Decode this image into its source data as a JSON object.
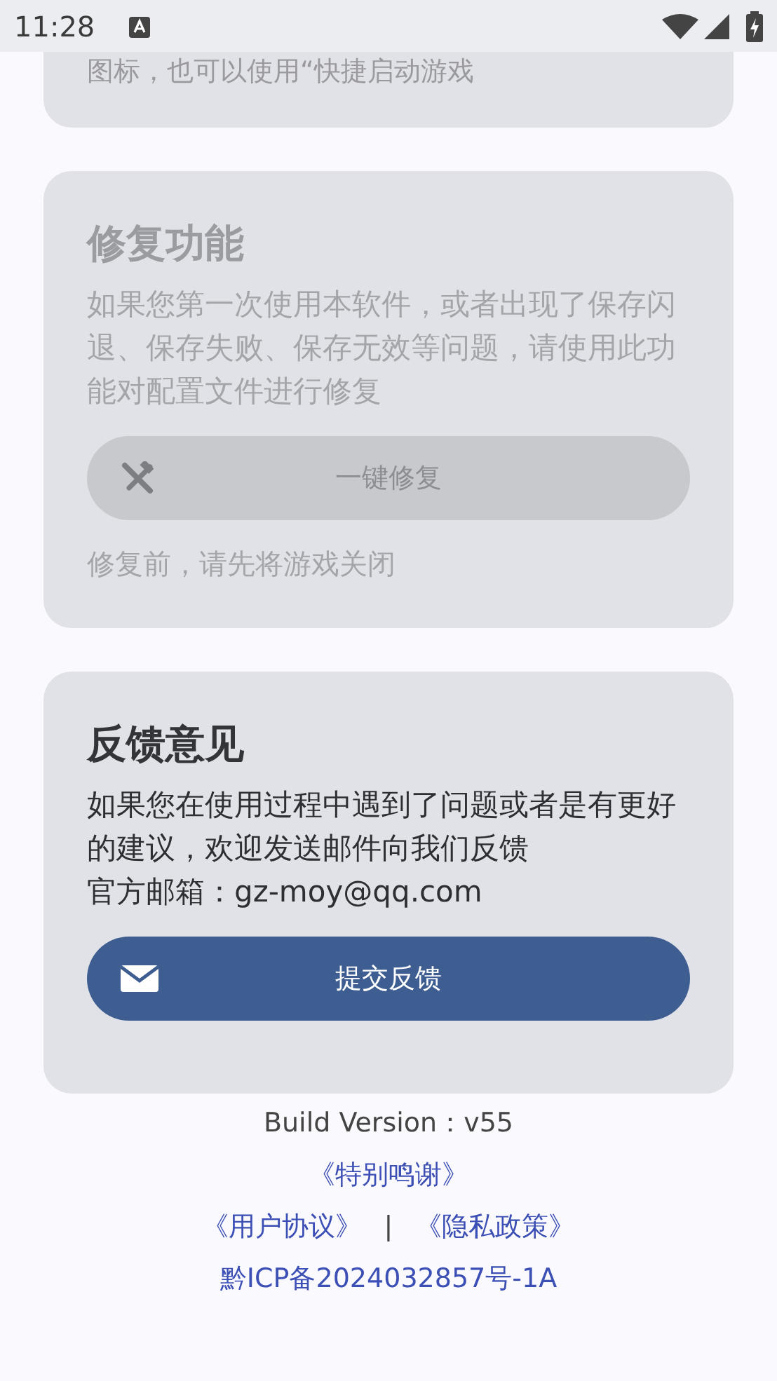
{
  "status_bar": {
    "time": "11:28"
  },
  "top_card": {
    "text": "图标，也可以使用“快捷启动游戏"
  },
  "repair_card": {
    "title": "修复功能",
    "description": "如果您第一次使用本软件，或者出现了保存闪退、保存失败、保存无效等问题，请使用此功能对配置文件进行修复",
    "button": {
      "label": "一键修复",
      "disabled": true
    },
    "note": "修复前，请先将游戏关闭",
    "disabled": true
  },
  "feedback_card": {
    "title": "反馈意见",
    "description": "如果您在使用过程中遇到了问题或者是有更好的建议，欢迎发送邮件向我们反馈",
    "email": "官方邮箱：gz-moy@qq.com",
    "button": {
      "label": "提交反馈",
      "disabled": false
    },
    "disabled": false
  },
  "footer": {
    "version": "Build Version：v55",
    "thanks_link": "《特别鸣谢》",
    "agreement_link": "《用户协议》",
    "separator": "|",
    "privacy_link": "《隐私政策》",
    "icp_link": "黔ICP备2024032857号-1A"
  }
}
